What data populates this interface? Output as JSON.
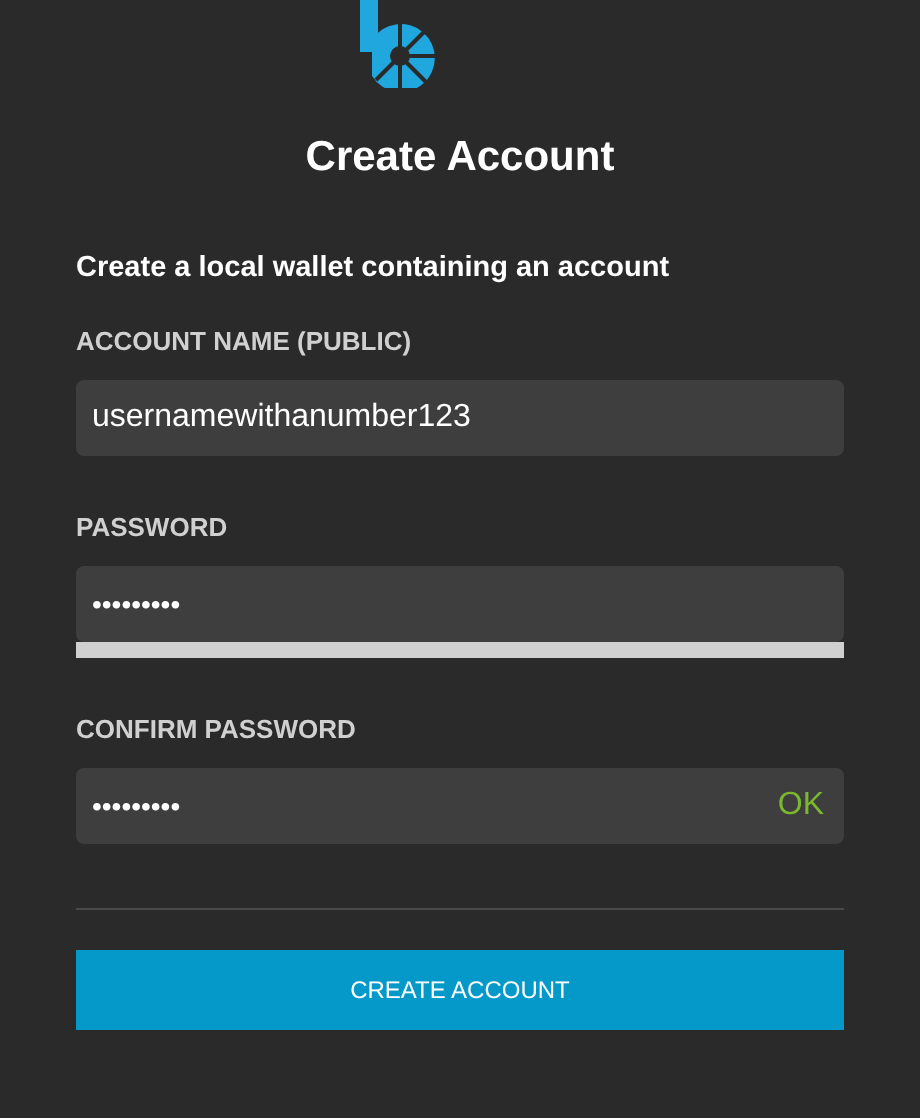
{
  "title": "Create Account",
  "subtitle": "Create a local wallet containing an account",
  "fields": [
    {
      "kind": "text",
      "label": "ACCOUNT NAME (PUBLIC)",
      "value": "usernamewithanumber123"
    },
    {
      "kind": "password",
      "label": "PASSWORD",
      "value": "•••••••••",
      "strength": {
        "level": 0
      }
    },
    {
      "kind": "password",
      "label": "CONFIRM PASSWORD",
      "value": "•••••••••",
      "status": "OK"
    }
  ],
  "button": "CREATE ACCOUNT"
}
